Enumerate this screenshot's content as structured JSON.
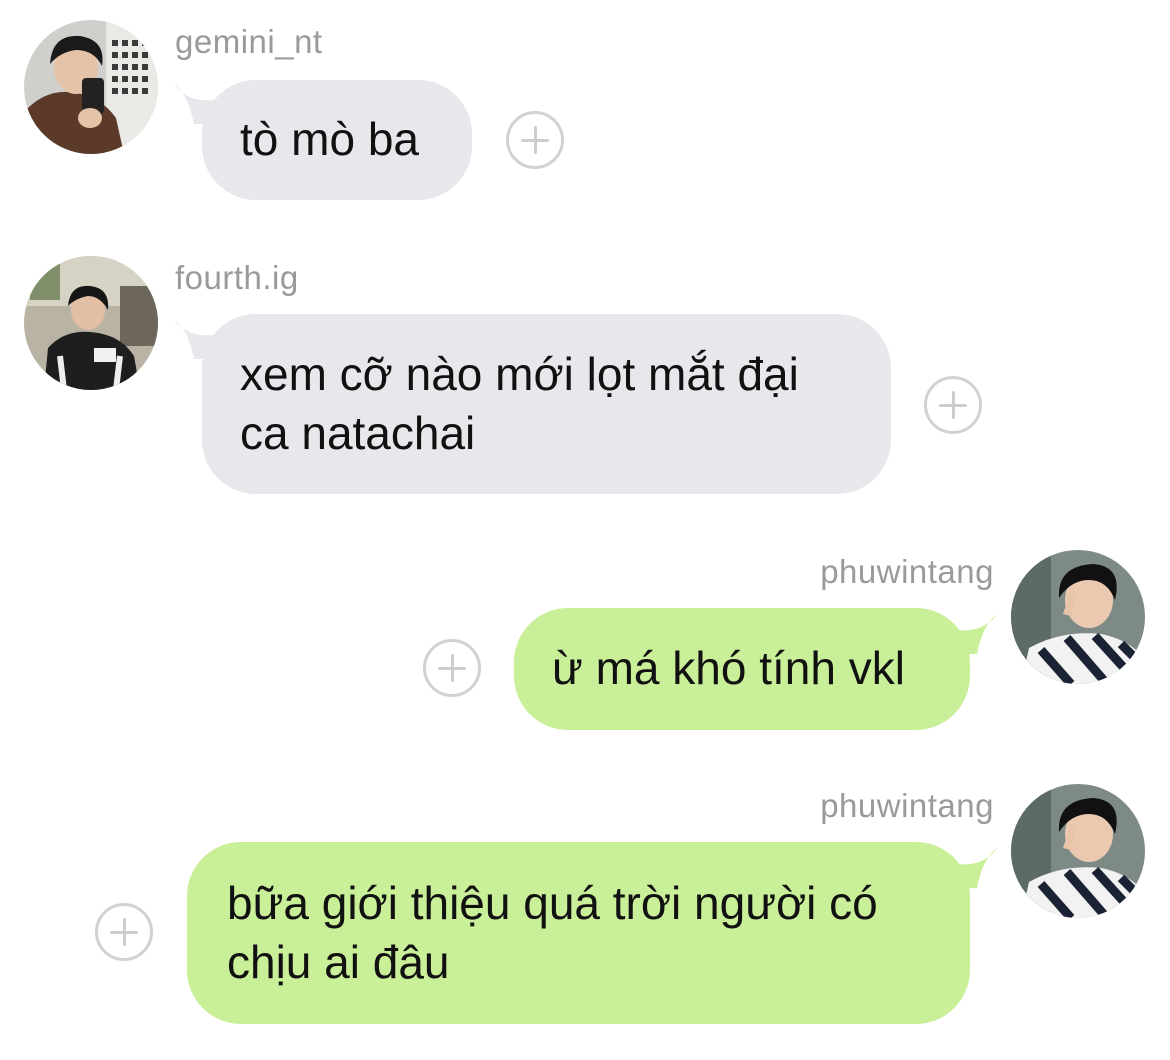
{
  "messages": [
    {
      "username": "gemini_nt",
      "direction": "incoming",
      "lines": [
        "tò mò ba"
      ],
      "avatar_icon": "profile-photo"
    },
    {
      "username": "fourth.ig",
      "direction": "incoming",
      "lines": [
        "xem cỡ nào mới lọt mắt đại",
        "ca natachai"
      ],
      "avatar_icon": "profile-photo"
    },
    {
      "username": "phuwintang",
      "direction": "outgoing",
      "lines": [
        "ừ má khó tính vkl"
      ],
      "avatar_icon": "profile-photo"
    },
    {
      "username": "phuwintang",
      "direction": "outgoing",
      "lines": [
        "bữa giới thiệu quá trời người có",
        "chịu ai đâu"
      ],
      "avatar_icon": "profile-photo"
    }
  ],
  "colors": {
    "incoming_bubble": "#e6e8ec",
    "outgoing_bubble": "#c9ef99",
    "username_text": "#9a9a9a",
    "message_text": "#111111",
    "reaction_icon": "#d2d2d2"
  },
  "react_icon": "add-reaction-icon"
}
